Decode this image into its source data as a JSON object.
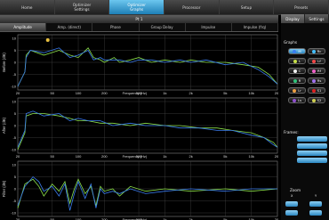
{
  "topnav": {
    "tabs": [
      {
        "label": "Home",
        "sub": ""
      },
      {
        "label": "Optimizer",
        "sub": "Settings"
      },
      {
        "label": "Optimizer",
        "sub": "Graphs"
      },
      {
        "label": "Processor",
        "sub": ""
      },
      {
        "label": "Setup",
        "sub": ""
      },
      {
        "label": "Presets",
        "sub": ""
      }
    ]
  },
  "title": "Pt 1",
  "subtabs": [
    "Amplitude",
    "Amp. (direct)",
    "Phase",
    "Group Delay",
    "Impulse",
    "Impulse (frq)"
  ],
  "graphs": {
    "ylabels": [
      "Before (dB)",
      "After (dB)",
      "Filter (dB)"
    ],
    "yticks": [
      "10",
      "5",
      "0",
      "-5",
      "-10"
    ],
    "xticks": [
      "20",
      "50",
      "100",
      "200",
      "500",
      "1k",
      "2k",
      "5k",
      "10k",
      "20k"
    ],
    "xlabel": "Frequency (Hz)"
  },
  "right": {
    "tabs": [
      "Display",
      "Settings"
    ],
    "graphs_label": "Graphs",
    "graph_buttons": [
      {
        "label": "M",
        "color": "#3b7df0"
      },
      {
        "label": "Rc",
        "color": "#44c0ff"
      },
      {
        "label": "L",
        "color": "#c8e048"
      },
      {
        "label": "Lf",
        "color": "#f24848"
      },
      {
        "label": "C",
        "color": "#f4f4f4"
      },
      {
        "label": "Rf",
        "color": "#f060c8"
      },
      {
        "label": "R",
        "color": "#2fc47a"
      },
      {
        "label": "Rs",
        "color": "#a070f0"
      },
      {
        "label": "Lr",
        "color": "#f0a040"
      },
      {
        "label": "S1",
        "color": "#e02020"
      },
      {
        "label": "Ls",
        "color": "#9050d0"
      },
      {
        "label": "S2",
        "color": "#d0d050"
      }
    ],
    "frames_label": "Frames:",
    "frame_buttons": [
      "",
      "",
      "",
      ""
    ],
    "zoom_label": "Zoom",
    "zoom_sub": [
      "X",
      "Y"
    ]
  },
  "colors": {
    "accent": "#2a86c0",
    "trace_green": "#8be04a",
    "trace_blue": "#3a7df0"
  }
}
